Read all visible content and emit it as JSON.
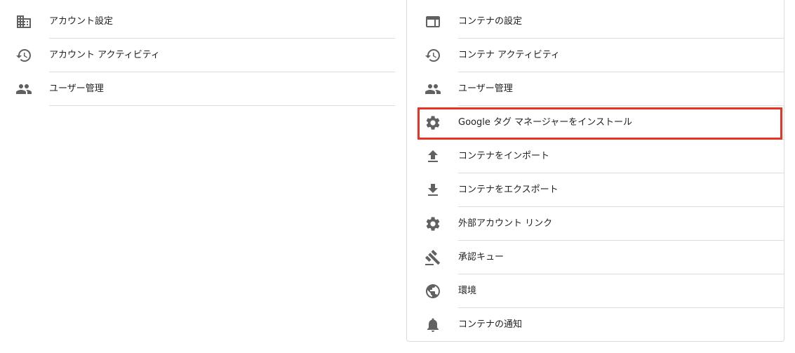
{
  "account_menu": {
    "items": [
      {
        "label": "アカウント設定",
        "icon": "building-icon"
      },
      {
        "label": "アカウント アクティビティ",
        "icon": "history-icon"
      },
      {
        "label": "ユーザー管理",
        "icon": "people-icon"
      }
    ]
  },
  "container_menu": {
    "items": [
      {
        "label": "コンテナの設定",
        "icon": "container-icon"
      },
      {
        "label": "コンテナ アクティビティ",
        "icon": "history-icon"
      },
      {
        "label": "ユーザー管理",
        "icon": "people-icon"
      },
      {
        "label": "Google タグ マネージャーをインストール",
        "icon": "gear-icon",
        "highlighted": true
      },
      {
        "label": "コンテナをインポート",
        "icon": "upload-icon"
      },
      {
        "label": "コンテナをエクスポート",
        "icon": "download-icon"
      },
      {
        "label": "外部アカウント リンク",
        "icon": "gear-icon"
      },
      {
        "label": "承認キュー",
        "icon": "gavel-icon"
      },
      {
        "label": "環境",
        "icon": "globe-icon"
      },
      {
        "label": "コンテナの通知",
        "icon": "bell-icon"
      }
    ]
  },
  "colors": {
    "highlight_border": "#e53526",
    "icon": "#616161",
    "divider": "#dcdcdc"
  }
}
